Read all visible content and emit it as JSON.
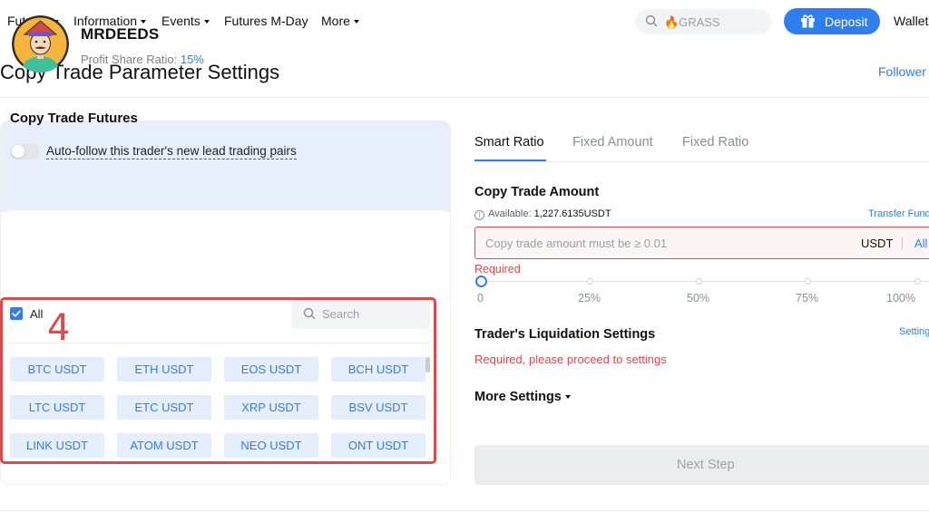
{
  "nav": {
    "items": [
      {
        "label": "Futures",
        "caret": true
      },
      {
        "label": "Information",
        "caret": true
      },
      {
        "label": "Events",
        "caret": true
      },
      {
        "label": "Futures M-Day",
        "caret": false
      },
      {
        "label": "More",
        "caret": true
      }
    ],
    "search_placeholder": "🔥GRASS",
    "deposit_label": "Deposit",
    "wallets_label": "Wallets"
  },
  "header": {
    "title": "Copy Trade Parameter Settings",
    "follower_link": "Follower C"
  },
  "trader": {
    "name": "MRDEEDS",
    "profit_share_label": "Profit Share Ratio:",
    "profit_share_value": "15%"
  },
  "copy_trade_futures": {
    "title": "Copy Trade Futures",
    "auto_follow_label": "Auto-follow this trader's new lead trading pairs",
    "auto_follow_on": false,
    "all_label": "All",
    "all_checked": true,
    "search_placeholder": "Search",
    "annotation_number": "4",
    "pairs": [
      "BTC USDT",
      "ETH USDT",
      "EOS USDT",
      "BCH USDT",
      "LTC USDT",
      "ETC USDT",
      "XRP USDT",
      "BSV USDT",
      "LINK USDT",
      "ATOM USDT",
      "NEO USDT",
      "ONT USDT"
    ]
  },
  "tabs": [
    {
      "label": "Smart Ratio",
      "active": true
    },
    {
      "label": "Fixed Amount",
      "active": false
    },
    {
      "label": "Fixed Ratio",
      "active": false
    }
  ],
  "amount": {
    "title": "Copy Trade Amount",
    "available_label": "Available:",
    "available_value": "1,227.6135USDT",
    "transfer_link": "Transfer Fund",
    "placeholder": "Copy trade amount must be ≥ 0.01",
    "unit": "USDT",
    "all_label": "All",
    "required_text": "Required",
    "slider_value_percent": 0,
    "slider_labels": [
      "0",
      "25%",
      "50%",
      "75%",
      "100%"
    ]
  },
  "liquidation": {
    "title": "Trader's Liquidation Settings",
    "settings_link": "Settings",
    "required_text": "Required, please proceed to settings"
  },
  "more_settings_label": "More Settings",
  "next_step_label": "Next Step",
  "colors": {
    "accent": "#2f7ef0",
    "error": "#e0494a",
    "chip_bg": "#e5eefc",
    "trader_card_bg": "#e7effc",
    "annotation": "#e0494a"
  }
}
